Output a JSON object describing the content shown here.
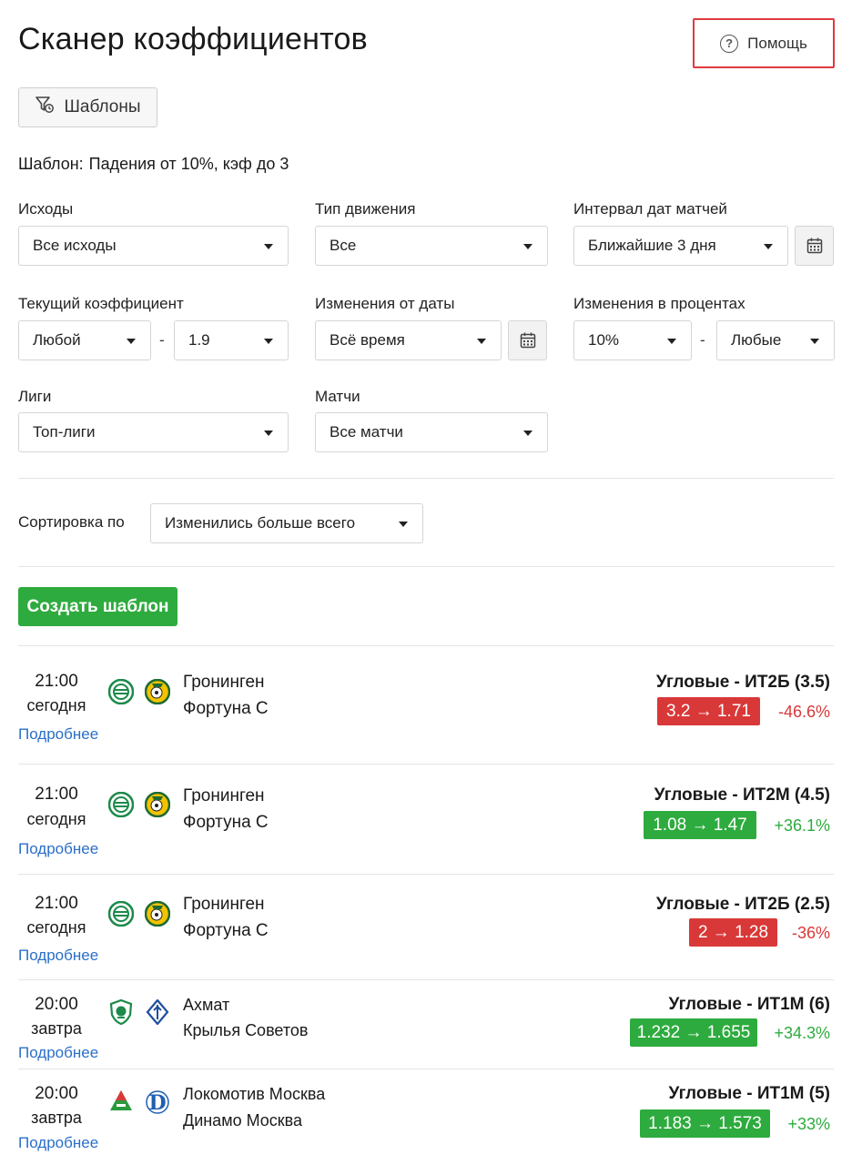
{
  "page": {
    "title": "Сканер коэффициентов"
  },
  "help": {
    "label": "Помощь",
    "icon": "question-circle-icon"
  },
  "templates": {
    "label": "Шаблоны",
    "icon": "filter-history-icon"
  },
  "template_line": {
    "label": "Шаблон:",
    "value": "Падения от 10%, кэф до 3"
  },
  "filters": {
    "outcomes": {
      "label": "Исходы",
      "value": "Все исходы"
    },
    "movement": {
      "label": "Тип движения",
      "value": "Все"
    },
    "date_interval": {
      "label": "Интервал дат матчей",
      "value": "Ближайшие 3 дня"
    },
    "current_odds": {
      "label": "Текущий коэффициент",
      "from": "Любой",
      "to": "1.9",
      "separator": "-"
    },
    "changes_from_date": {
      "label": "Изменения от даты",
      "value": "Всё время"
    },
    "changes_percent": {
      "label": "Изменения в процентах",
      "from": "10%",
      "to": "Любые",
      "separator": "-"
    },
    "leagues": {
      "label": "Лиги",
      "value": "Топ-лиги"
    },
    "matches": {
      "label": "Матчи",
      "value": "Все матчи"
    }
  },
  "sort": {
    "label": "Сортировка по",
    "value": "Изменились больше всего"
  },
  "create_template": {
    "label": "Создать шаблон"
  },
  "colors": {
    "accent_green": "#2eab3e",
    "drop_red": "#d93838",
    "link_blue": "#2a6fc7",
    "help_border_red": "#e03a3e"
  },
  "matches": [
    {
      "time": "21:00",
      "day": "сегодня",
      "more": "Подробнее",
      "home": "Гронинген",
      "away": "Фортуна С",
      "home_logo": "groningen-logo-icon",
      "away_logo": "fortuna-sittard-logo-icon",
      "market": "Угловые - ИТ2Б (3.5)",
      "change": "3.2 → 1.71",
      "pct": "-46.6%",
      "direction": "down"
    },
    {
      "time": "21:00",
      "day": "сегодня",
      "more": "Подробнее",
      "home": "Гронинген",
      "away": "Фортуна С",
      "home_logo": "groningen-logo-icon",
      "away_logo": "fortuna-sittard-logo-icon",
      "market": "Угловые - ИТ2М (4.5)",
      "change": "1.08 → 1.47",
      "pct": "+36.1%",
      "direction": "up"
    },
    {
      "time": "21:00",
      "day": "сегодня",
      "more": "Подробнее",
      "home": "Гронинген",
      "away": "Фортуна С",
      "home_logo": "groningen-logo-icon",
      "away_logo": "fortuna-sittard-logo-icon",
      "market": "Угловые - ИТ2Б (2.5)",
      "change": "2 → 1.28",
      "pct": "-36%",
      "direction": "down"
    },
    {
      "time": "20:00",
      "day": "завтра",
      "more": "Подробнее",
      "home": "Ахмат",
      "away": "Крылья Советов",
      "home_logo": "akhmat-logo-icon",
      "away_logo": "krylia-sovetov-logo-icon",
      "market": "Угловые - ИТ1М (6)",
      "change": "1.232 → 1.655",
      "pct": "+34.3%",
      "direction": "up"
    },
    {
      "time": "20:00",
      "day": "завтра",
      "more": "Подробнее",
      "home": "Локомотив Москва",
      "away": "Динамо Москва",
      "home_logo": "lokomotiv-logo-icon",
      "away_logo": "dynamo-logo-icon",
      "market": "Угловые - ИТ1М (5)",
      "change": "1.183 → 1.573",
      "pct": "+33%",
      "direction": "up"
    }
  ]
}
